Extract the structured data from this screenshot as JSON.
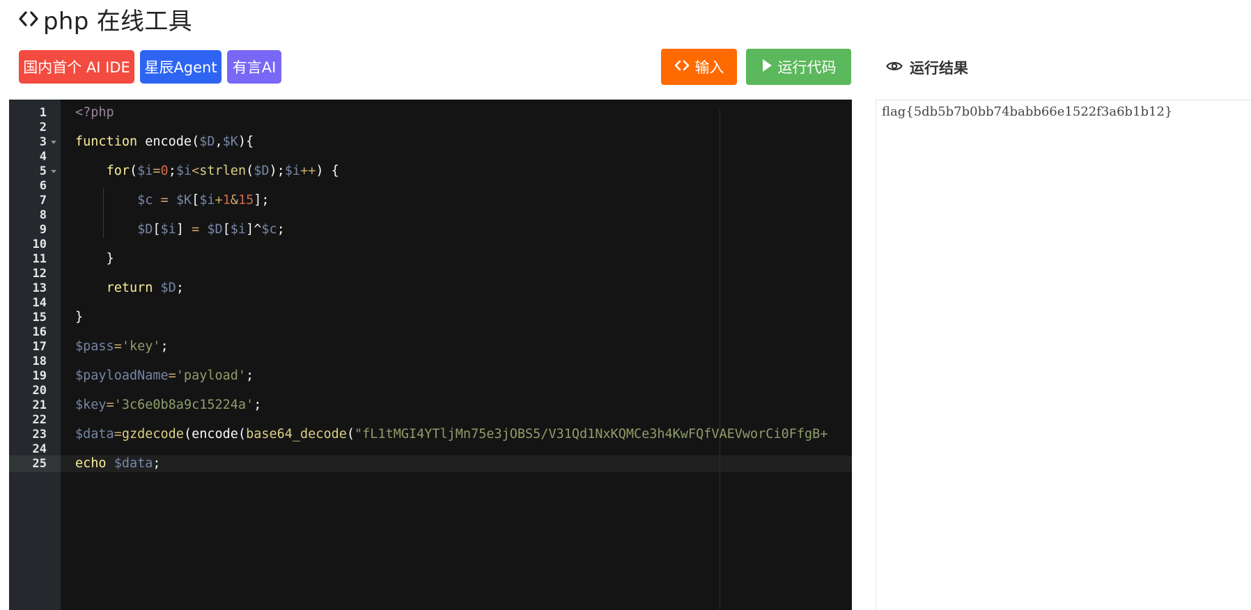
{
  "header": {
    "title": "php 在线工具",
    "title_icon": "code-brackets-icon"
  },
  "promo_buttons": [
    {
      "label": "国内首个 AI IDE",
      "color": "#f34b40"
    },
    {
      "label": "星辰Agent",
      "color": "#2d64f2"
    },
    {
      "label": "有言AI",
      "color": "#7967f5"
    }
  ],
  "actions": {
    "input_label": "输入",
    "input_icon": "code-brackets-icon",
    "input_color": "#ff6a00",
    "run_label": "运行代码",
    "run_icon": "play-icon",
    "run_color": "#5cb85c"
  },
  "result": {
    "header_label": "运行结果",
    "header_icon": "eye-icon",
    "output": "flag{5db5b7b0bb74babb66e1522f3a6b1b12}"
  },
  "editor": {
    "line_numbers": [
      "1",
      "2",
      "3",
      "4",
      "5",
      "6",
      "7",
      "8",
      "9",
      "10",
      "11",
      "12",
      "13",
      "14",
      "15",
      "16",
      "17",
      "18",
      "19",
      "20",
      "21",
      "22",
      "23",
      "24",
      "25"
    ],
    "active_line": 25,
    "lines": [
      [
        [
          "meta",
          "<?php"
        ]
      ],
      [],
      [
        [
          "kw",
          "function"
        ],
        [
          "txt",
          " encode("
        ],
        [
          "var",
          "$D"
        ],
        [
          "txt",
          ","
        ],
        [
          "var",
          "$K"
        ],
        [
          "txt",
          "){"
        ]
      ],
      [],
      [
        [
          "txt",
          "    "
        ],
        [
          "kw",
          "for"
        ],
        [
          "txt",
          "("
        ],
        [
          "var",
          "$i"
        ],
        [
          "op",
          "="
        ],
        [
          "num",
          "0"
        ],
        [
          "txt",
          ";"
        ],
        [
          "var",
          "$i"
        ],
        [
          "op",
          "<"
        ],
        [
          "fn",
          "strlen"
        ],
        [
          "txt",
          "("
        ],
        [
          "var",
          "$D"
        ],
        [
          "txt",
          ");"
        ],
        [
          "var",
          "$i"
        ],
        [
          "op",
          "++"
        ],
        [
          "txt",
          ") {"
        ]
      ],
      [],
      [
        [
          "txt",
          "        "
        ],
        [
          "var",
          "$c"
        ],
        [
          "txt",
          " "
        ],
        [
          "op",
          "="
        ],
        [
          "txt",
          " "
        ],
        [
          "var",
          "$K"
        ],
        [
          "txt",
          "["
        ],
        [
          "var",
          "$i"
        ],
        [
          "op",
          "+"
        ],
        [
          "num",
          "1"
        ],
        [
          "op",
          "&"
        ],
        [
          "num",
          "15"
        ],
        [
          "txt",
          "];"
        ]
      ],
      [],
      [
        [
          "txt",
          "        "
        ],
        [
          "var",
          "$D"
        ],
        [
          "txt",
          "["
        ],
        [
          "var",
          "$i"
        ],
        [
          "txt",
          "] "
        ],
        [
          "op",
          "="
        ],
        [
          "txt",
          " "
        ],
        [
          "var",
          "$D"
        ],
        [
          "txt",
          "["
        ],
        [
          "var",
          "$i"
        ],
        [
          "txt",
          "]^"
        ],
        [
          "var",
          "$c"
        ],
        [
          "txt",
          ";"
        ]
      ],
      [],
      [
        [
          "txt",
          "    }"
        ]
      ],
      [],
      [
        [
          "txt",
          "    "
        ],
        [
          "kw",
          "return"
        ],
        [
          "txt",
          " "
        ],
        [
          "var",
          "$D"
        ],
        [
          "txt",
          ";"
        ]
      ],
      [],
      [
        [
          "txt",
          "}"
        ]
      ],
      [],
      [
        [
          "var",
          "$pass"
        ],
        [
          "op",
          "="
        ],
        [
          "str",
          "'key'"
        ],
        [
          "txt",
          ";"
        ]
      ],
      [],
      [
        [
          "var",
          "$payloadName"
        ],
        [
          "op",
          "="
        ],
        [
          "str",
          "'payload'"
        ],
        [
          "txt",
          ";"
        ]
      ],
      [],
      [
        [
          "var",
          "$key"
        ],
        [
          "op",
          "="
        ],
        [
          "str",
          "'3c6e0b8a9c15224a'"
        ],
        [
          "txt",
          ";"
        ]
      ],
      [],
      [
        [
          "var",
          "$data"
        ],
        [
          "op",
          "="
        ],
        [
          "fn",
          "gzdecode"
        ],
        [
          "txt",
          "(encode("
        ],
        [
          "fn",
          "base64_decode"
        ],
        [
          "txt",
          "("
        ],
        [
          "str",
          "\"fL1tMGI4YTljMn75e3jOBS5/V31Qd1NxKQMCe3h4KwFQfVAEVworCi0FfgB+"
        ]
      ],
      [],
      [
        [
          "kw",
          "echo"
        ],
        [
          "txt",
          " "
        ],
        [
          "var",
          "$data"
        ],
        [
          "txt",
          ";"
        ]
      ]
    ],
    "fold_lines": [
      3,
      5
    ]
  }
}
